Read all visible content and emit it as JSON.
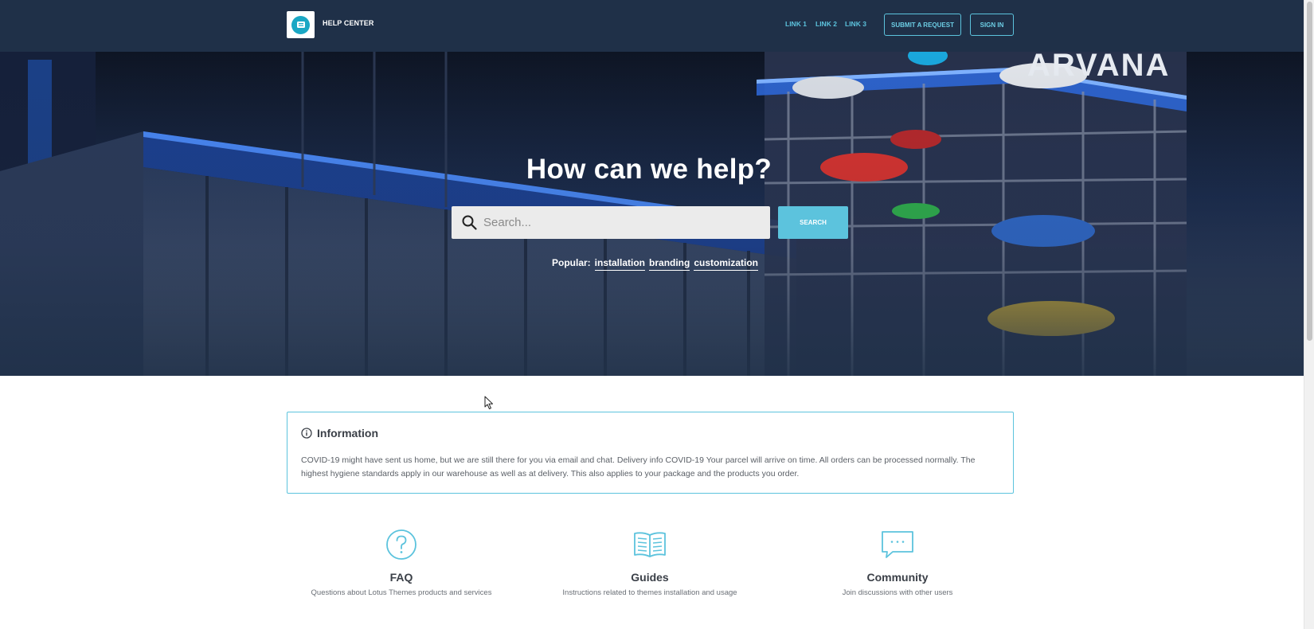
{
  "header": {
    "title": "HELP CENTER",
    "nav": [
      {
        "label": "LINK 1"
      },
      {
        "label": "LINK 2"
      },
      {
        "label": "LINK 3"
      }
    ],
    "submit_label": "SUBMIT A REQUEST",
    "signin_label": "SIGN IN"
  },
  "hero": {
    "title": "How can we help?",
    "search_placeholder": "Search...",
    "search_button": "SEARCH",
    "popular_label": "Popular:",
    "popular_tags": [
      "installation",
      "branding",
      "customization"
    ]
  },
  "info": {
    "title": "Information",
    "text": "COVID-19 might have sent us home, but we are still there for you via email and chat. Delivery info COVID-19 Your parcel will arrive on time. All orders can be processed normally. The highest hygiene standards apply in our warehouse as well as at delivery. This also applies to your package and the products you order."
  },
  "categories": [
    {
      "icon": "question-circle-icon",
      "title": "FAQ",
      "desc": "Questions about Lotus Themes products and services"
    },
    {
      "icon": "open-book-icon",
      "title": "Guides",
      "desc": "Instructions related to themes installation and usage"
    },
    {
      "icon": "chat-bubble-icon",
      "title": "Community",
      "desc": "Join discussions with other users"
    }
  ],
  "colors": {
    "header_bg": "#1f3048",
    "accent": "#5cc3dd",
    "text_dark": "#3a3f47"
  }
}
